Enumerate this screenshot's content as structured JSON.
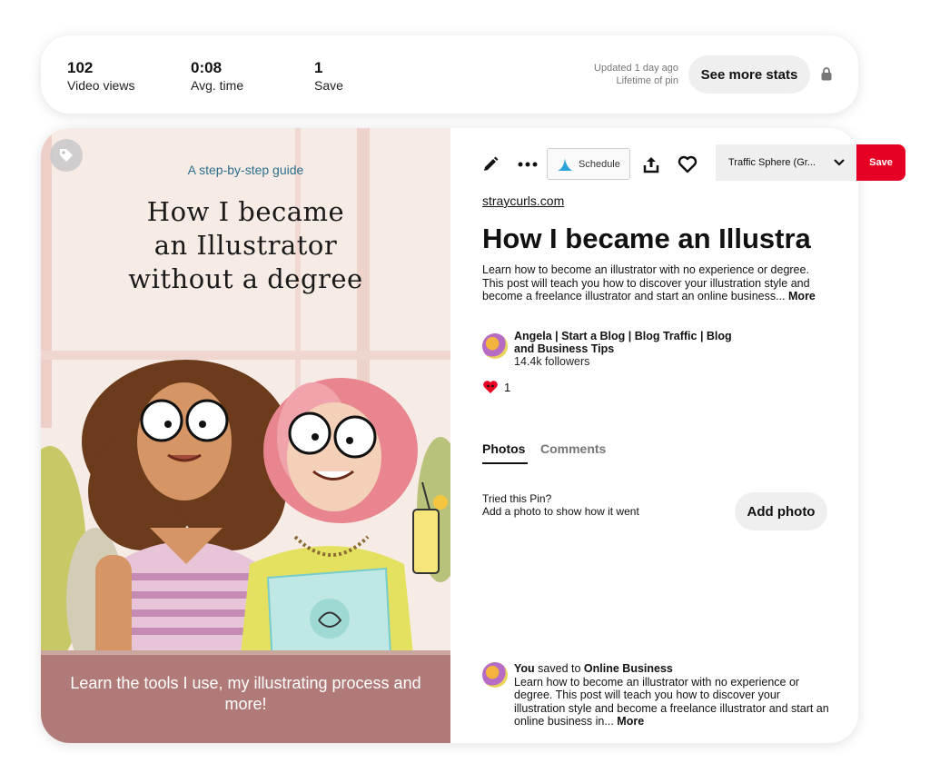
{
  "stats": {
    "items": [
      {
        "value": "102",
        "label": "Video views"
      },
      {
        "value": "0:08",
        "label": "Avg. time"
      },
      {
        "value": "1",
        "label": "Save"
      }
    ],
    "updated": "Updated 1 day ago",
    "lifetime": "Lifetime of pin",
    "see_more_label": "See more stats"
  },
  "image": {
    "kicker": "A step-by-step guide",
    "title_lines": [
      "How I became",
      "an Illustrator",
      "without a degree"
    ],
    "caption": "Learn the tools I use, my illustrating process and more!"
  },
  "toolbar": {
    "schedule_label": "Schedule",
    "board": "Traffic Sphere (Gr...",
    "save_label": "Save"
  },
  "pin": {
    "domain": "straycurls.com",
    "title": "How I became an Illustra",
    "description": "Learn how to become an illustrator with no experience or degree. This post will teach you how to discover your illustration style and become a freelance illustrator and start an online business...",
    "more": "More"
  },
  "creator": {
    "name": "Angela | Start a Blog | Blog Traffic | Blog and Business Tips",
    "followers": "14.4k followers"
  },
  "reactions": {
    "count": "1"
  },
  "tabs": [
    {
      "label": "Photos"
    },
    {
      "label": "Comments"
    }
  ],
  "tried": {
    "line1": "Tried this Pin?",
    "line2": "Add a photo to show how it went",
    "button": "Add photo"
  },
  "activity": {
    "you": "You",
    "saved_to": "saved to",
    "board": "Online Business",
    "description": "Learn how to become an illustrator with no experience or degree. This post will teach you how to discover your illustration style and become a freelance illustrator and start an online business in...",
    "more": "More"
  },
  "colors": {
    "save_red": "#e60023",
    "banner": "#b07a78",
    "kicker": "#2d6f8c"
  }
}
